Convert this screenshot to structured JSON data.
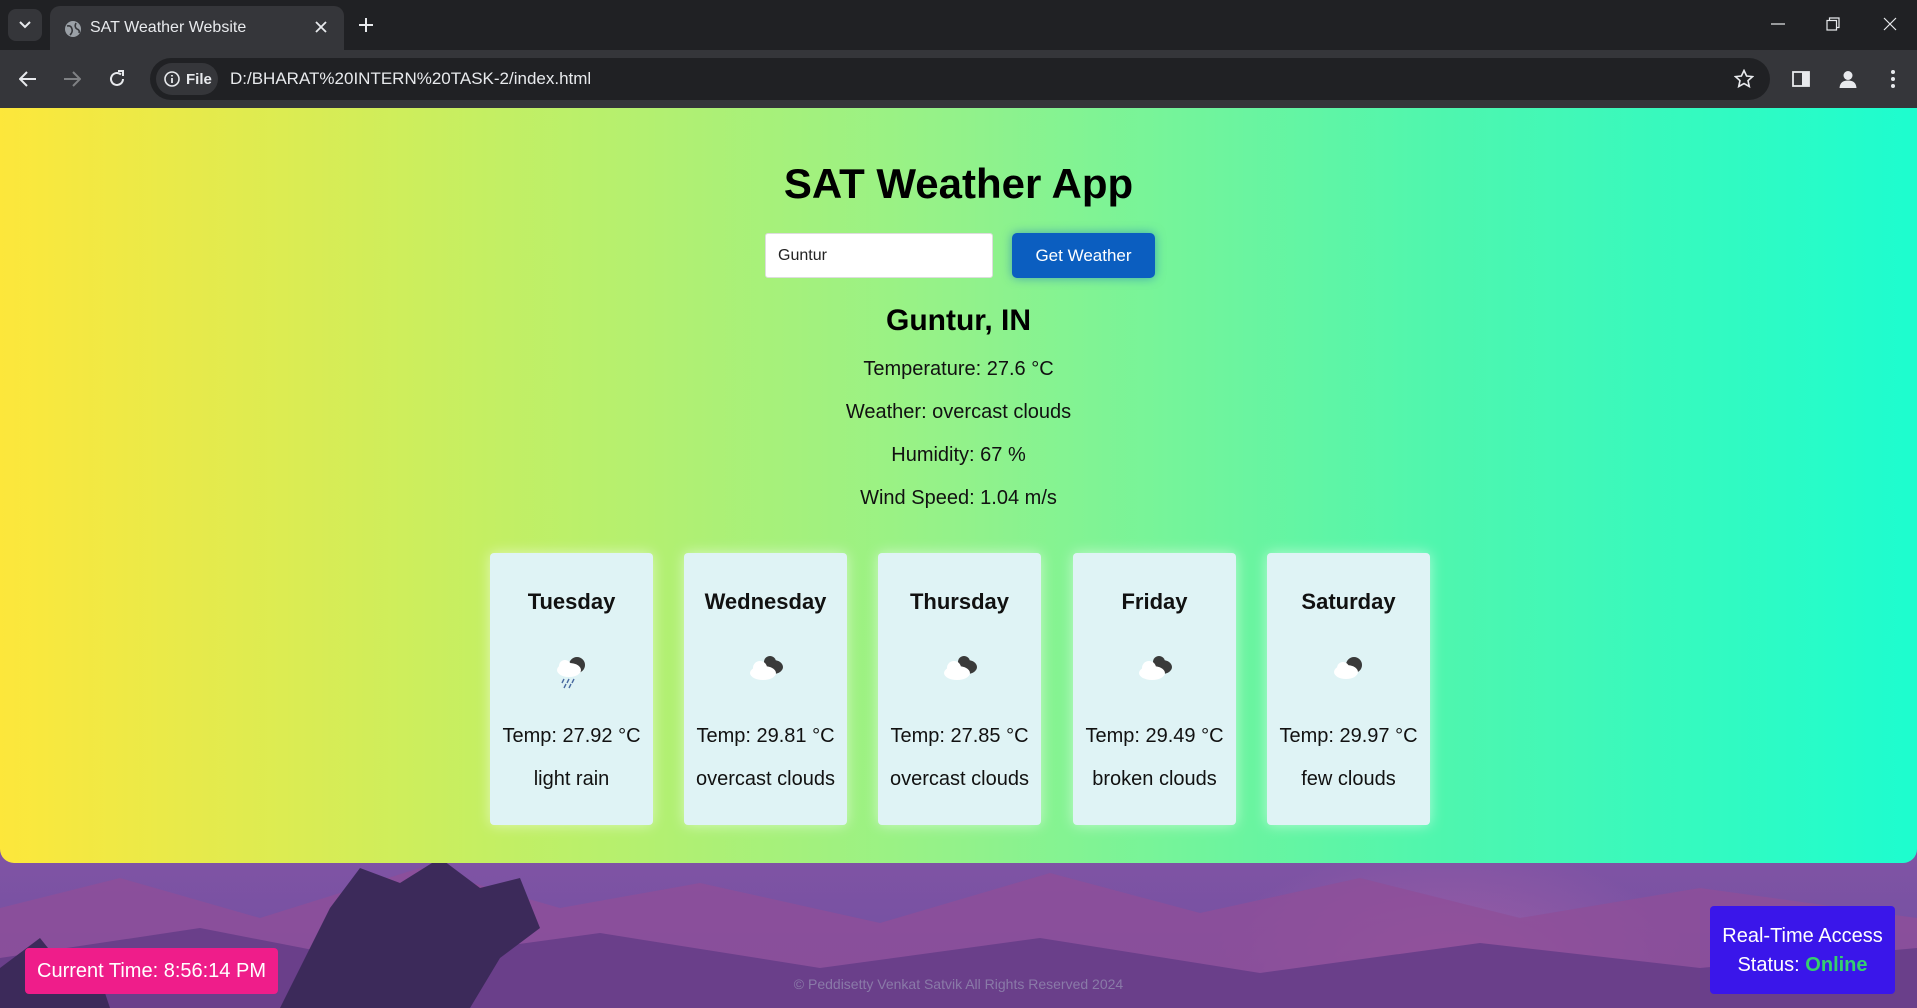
{
  "browser": {
    "tab_title": "SAT Weather Website",
    "address_chip": "File",
    "url": "D:/BHARAT%20INTERN%20TASK-2/index.html"
  },
  "app": {
    "title": "SAT Weather App",
    "search": {
      "value": "Guntur",
      "button_label": "Get Weather"
    },
    "location": "Guntur, IN",
    "temperature": "Temperature: 27.6 °C",
    "weather": "Weather: overcast clouds",
    "humidity": "Humidity: 67 %",
    "wind": "Wind Speed: 1.04 m/s"
  },
  "forecast": [
    {
      "day": "Tuesday",
      "icon": "rain-cloud-icon",
      "temp": "Temp: 27.92 °C",
      "desc": "light rain"
    },
    {
      "day": "Wednesday",
      "icon": "overcast-clouds-icon",
      "temp": "Temp: 29.81 °C",
      "desc": "overcast clouds"
    },
    {
      "day": "Thursday",
      "icon": "overcast-clouds-icon",
      "temp": "Temp: 27.85 °C",
      "desc": "overcast clouds"
    },
    {
      "day": "Friday",
      "icon": "broken-clouds-icon",
      "temp": "Temp: 29.49 °C",
      "desc": "broken clouds"
    },
    {
      "day": "Saturday",
      "icon": "few-clouds-icon",
      "temp": "Temp: 29.97 °C",
      "desc": "few clouds"
    }
  ],
  "bottom": {
    "current_time": "Current Time: 8:56:14 PM",
    "footer": "© Peddisetty Venkat Satvik All Rights Reserved 2024",
    "status_line1": "Real-Time Access",
    "status_label": "Status:",
    "status_value": "Online"
  },
  "colors": {
    "button": "#0b5ec0",
    "time_badge": "#ef1d8a",
    "status_box": "#3a16ea",
    "online": "#35d06d"
  }
}
